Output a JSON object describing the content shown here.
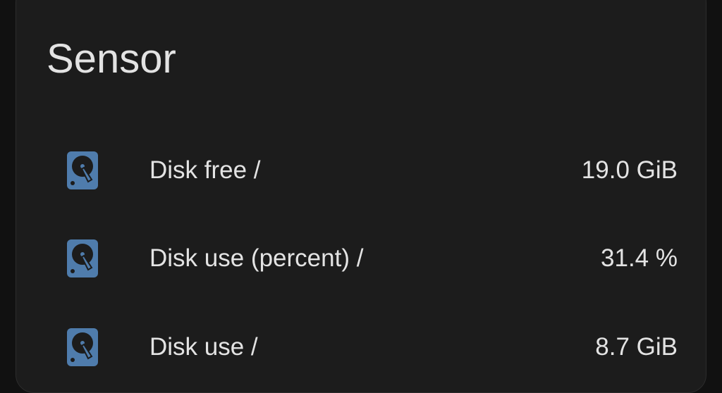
{
  "card": {
    "title": "Sensor",
    "accent_icon_color": "#4f7cac",
    "rows": [
      {
        "icon": "harddisk-icon",
        "name": "Disk free /",
        "state": "19.0 GiB"
      },
      {
        "icon": "harddisk-icon",
        "name": "Disk use (percent) /",
        "state": "31.4 %"
      },
      {
        "icon": "harddisk-icon",
        "name": "Disk use /",
        "state": "8.7 GiB"
      }
    ]
  }
}
